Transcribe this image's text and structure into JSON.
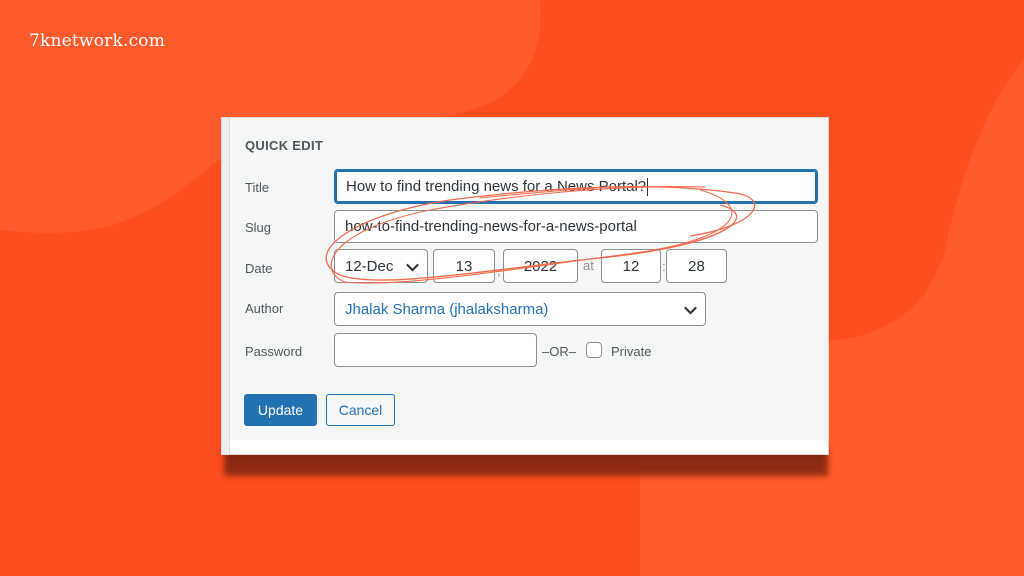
{
  "brand": {
    "text": "7knetwork.com"
  },
  "colors": {
    "background": "#fe4d1e",
    "background_shape": "#ff5a2b",
    "primary": "#2271b1",
    "annotation": "#f26a4b"
  },
  "quick_edit": {
    "heading": "QUICK EDIT",
    "fields": {
      "title": {
        "label": "Title",
        "value": "How to find trending news for a News Portal?"
      },
      "slug": {
        "label": "Slug",
        "value": "how-to-find-trending-news-for-a-news-portal"
      },
      "date": {
        "label": "Date",
        "month": "12-Dec",
        "day": "13",
        "day_sep": ",",
        "year": "2022",
        "at_label": "at",
        "hour": "12",
        "time_sep": ":",
        "minute": "28"
      },
      "author": {
        "label": "Author",
        "value": "Jhalak Sharma (jhalaksharma)"
      },
      "password": {
        "label": "Password",
        "value": "",
        "or_label": "–OR–",
        "private_label": "Private",
        "private_checked": false
      }
    },
    "buttons": {
      "update": "Update",
      "cancel": "Cancel"
    }
  }
}
